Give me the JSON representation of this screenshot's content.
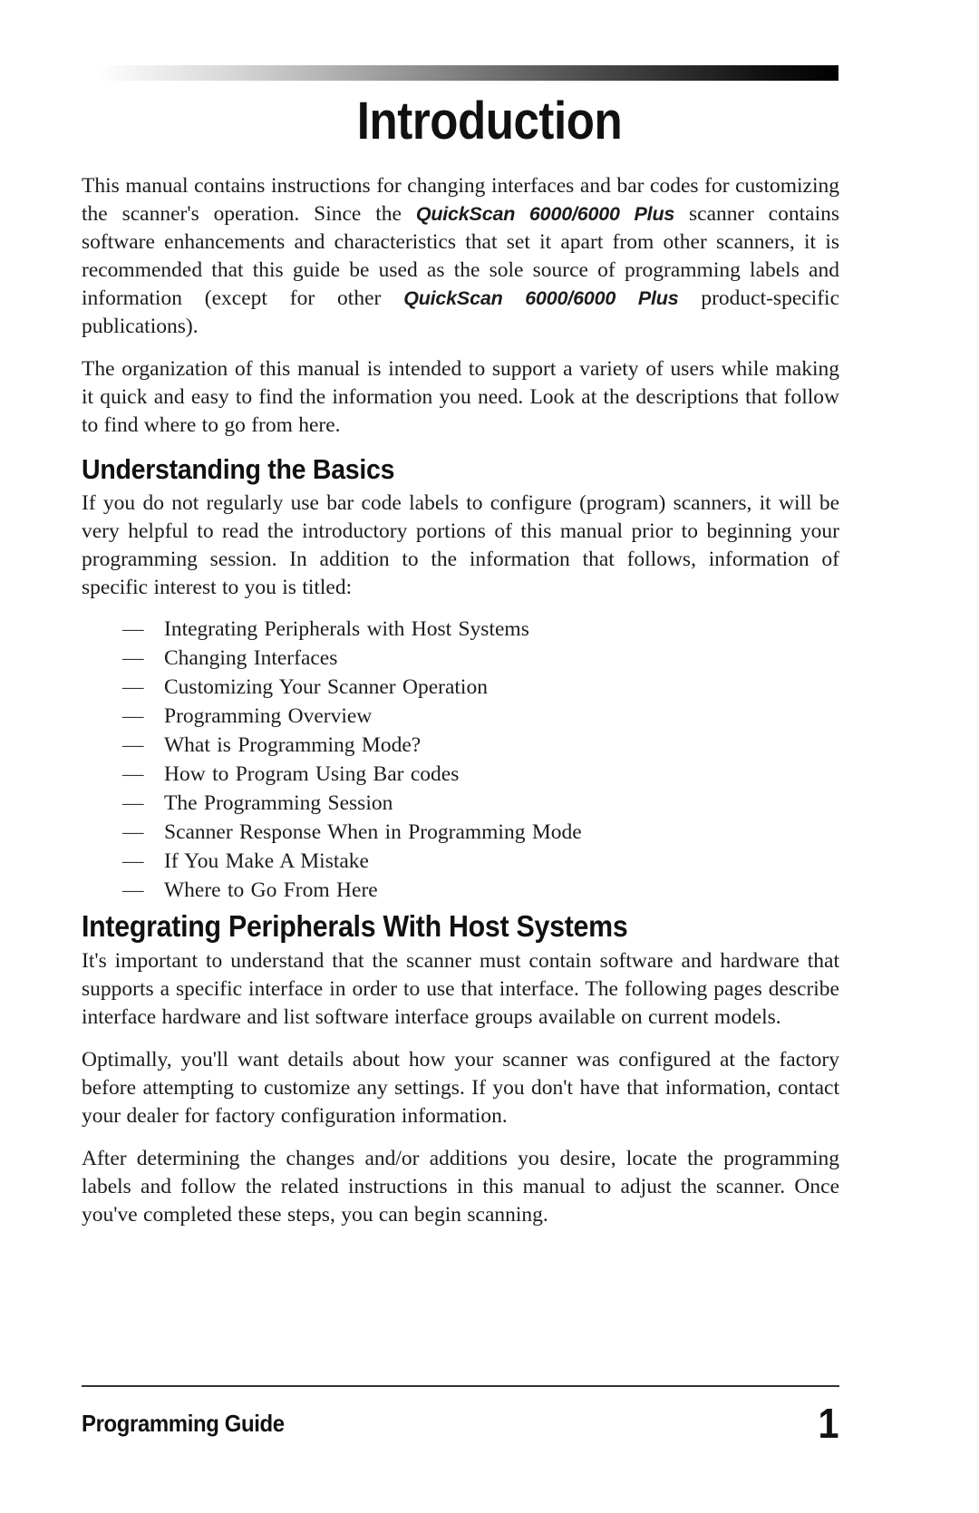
{
  "document": {
    "title": "Introduction",
    "product_name": "QuickScan 6000/6000 Plus"
  },
  "header": {
    "gradient_from": "#ffffff",
    "gradient_to": "#000000"
  },
  "intro": {
    "paragraph_1_part_1": "This manual contains instructions for changing interfaces and bar codes for customizing the scanner's operation.  Since the ",
    "paragraph_1_model_1": "QuickScan 6000/6000 Plus",
    "paragraph_1_part_2": " scanner contains software enhancements and characteristics that set it apart from other scanners, it is recommended that this guide be used as the sole source of programming labels and information (except for other ",
    "paragraph_1_model_2": "QuickScan 6000/6000 Plus",
    "paragraph_1_part_3": " product-specific publications).",
    "paragraph_2": "The organization of this manual is intended to support a variety of users while making it quick and easy to find the information you need.  Look at the descriptions that follow to find where to go from here."
  },
  "basics": {
    "heading": "Understanding the Basics",
    "paragraph": "If you do not regularly use bar code labels to configure (program) scanners, it will be very helpful to read the introductory portions of this manual prior to beginning your programming session.  In addition to the information that follows, information of specific interest to you is titled:",
    "bullet": "—",
    "items": [
      "Integrating Peripherals with Host Systems",
      "Changing Interfaces",
      "Customizing Your Scanner Operation",
      "Programming Overview",
      "What is Programming Mode?",
      "How to Program Using Bar codes",
      "The Programming Session",
      "Scanner Response When in Programming Mode",
      "If You Make A Mistake",
      "Where to Go From Here"
    ]
  },
  "integrating": {
    "heading": "Integrating Peripherals With Host Systems",
    "paragraph_1": "It's important to understand that the scanner must contain software and hardware that supports a specific interface in order to use that interface.  The following pages describe interface hardware and list software interface groups available on current models.",
    "paragraph_2": "Optimally, you'll want details about how your scanner was configured at the factory before attempting to customize any settings.  If you don't have that information, contact your dealer for factory configuration information.",
    "paragraph_3": "After determining the changes and/or additions you desire, locate the programming labels and follow the related instructions in this manual to adjust the scanner.  Once you've completed these steps, you can begin scanning."
  },
  "footer": {
    "guide_label": "Programming Guide",
    "page_number": "1"
  }
}
